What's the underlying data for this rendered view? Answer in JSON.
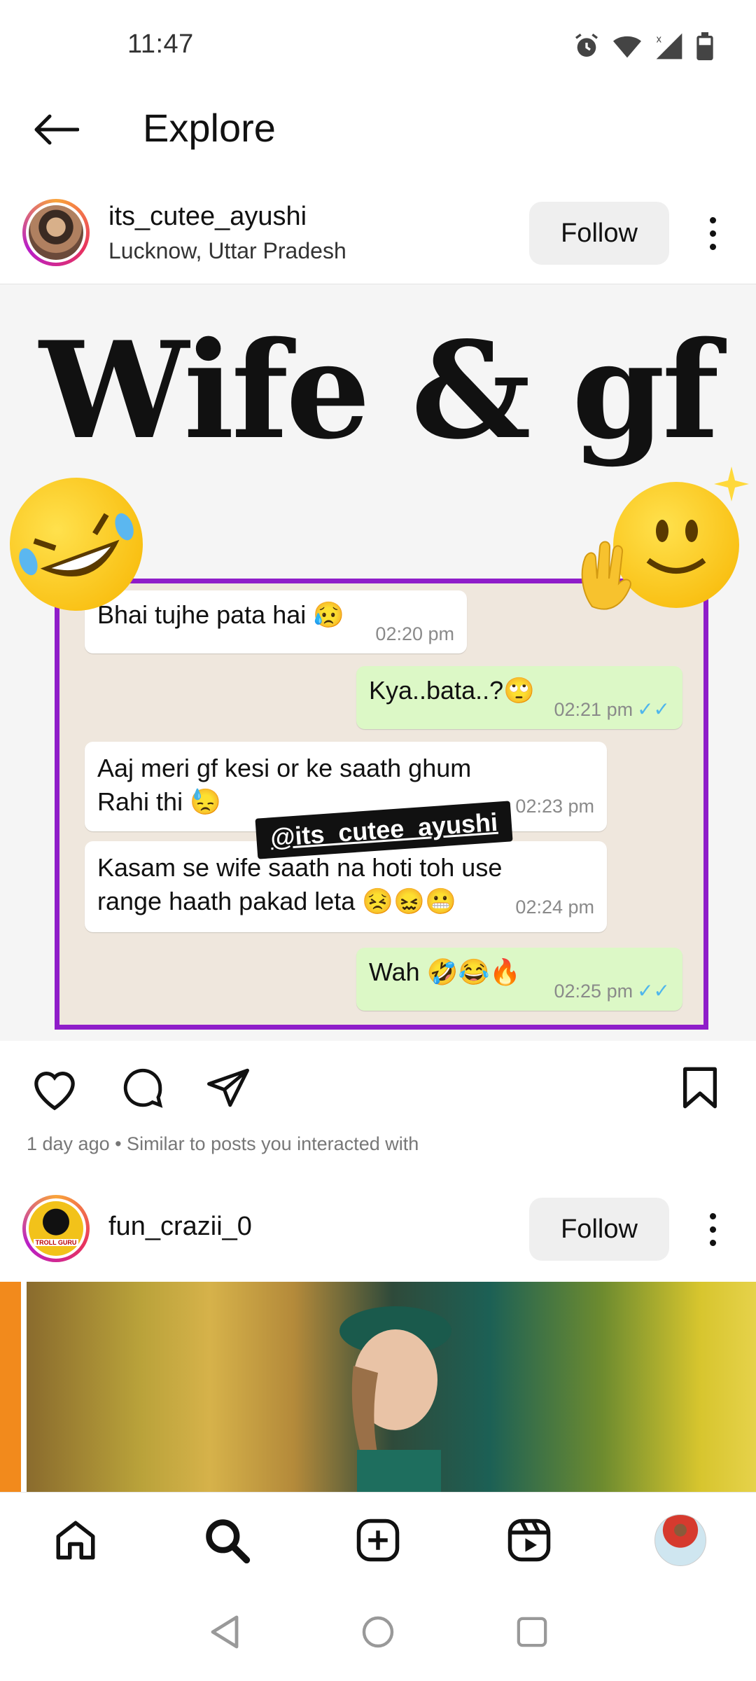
{
  "status_bar": {
    "time": "11:47"
  },
  "header": {
    "title": "Explore"
  },
  "post1": {
    "username": "its_cutee_ayushi",
    "location": "Lucknow, Uttar Pradesh",
    "follow_label": "Follow",
    "image": {
      "title": "Wife & gf",
      "watermark": "@its_cutee_ayushi",
      "messages": [
        {
          "text": "Bhai tujhe pata hai 😥",
          "time": "02:20 pm",
          "direction": "in"
        },
        {
          "text": "Kya..bata..?🙄",
          "time": "02:21 pm",
          "direction": "out"
        },
        {
          "text": "Aaj meri gf kesi or ke saath ghum Rahi thi 😓",
          "time": "02:23 pm",
          "direction": "in"
        },
        {
          "text": "Kasam se wife saath na hoti toh use range haath pakad leta 😣😖😬",
          "time": "02:24 pm",
          "direction": "in"
        },
        {
          "text": "Wah 🤣😂🔥",
          "time": "02:25 pm",
          "direction": "out"
        }
      ]
    },
    "meta": "1 day ago • Similar to posts you interacted with"
  },
  "post2": {
    "username": "fun_crazii_0",
    "follow_label": "Follow",
    "avatar_text": "TROLL GURU"
  },
  "icons": {
    "back": "arrow-left-icon",
    "like": "heart-icon",
    "comment": "comment-icon",
    "share": "send-icon",
    "save": "bookmark-icon",
    "home": "home-icon",
    "search": "search-icon",
    "create": "plus-square-icon",
    "reels": "reels-icon"
  },
  "colors": {
    "accent_frame": "#8f1dc9",
    "follow_bg": "#efefef",
    "chat_out": "#dcf8c6"
  }
}
